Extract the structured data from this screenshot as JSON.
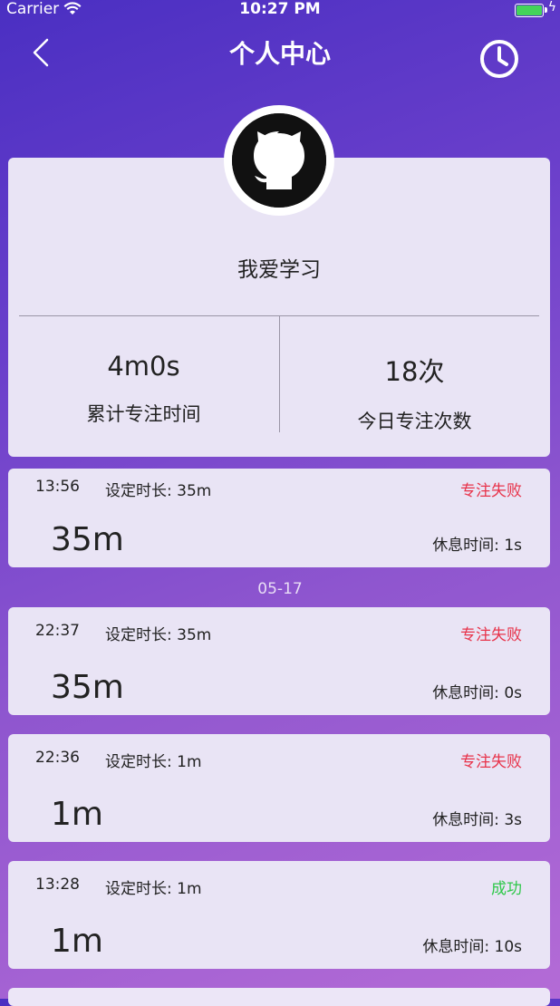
{
  "status_bar": {
    "carrier": "Carrier",
    "time": "10:27 PM"
  },
  "nav": {
    "title": "个人中心",
    "back_icon": "chevron-left-icon",
    "history_icon": "clock-icon"
  },
  "profile": {
    "avatar_icon": "github-octocat-icon",
    "username": "我爱学习",
    "stats": [
      {
        "value": "4m0s",
        "label": "累计专注时间"
      },
      {
        "value": "18次",
        "label": "今日专注次数"
      }
    ]
  },
  "records_top": [
    {
      "time": "13:56",
      "setting": "设定时长:  35m",
      "status": "专注失败",
      "duration": "35m",
      "rest": "休息时间: 1s"
    }
  ],
  "date_separator": "05-17",
  "records": [
    {
      "time": "22:37",
      "setting": "设定时长:  35m",
      "status": "专注失败",
      "duration": "35m",
      "rest": "休息时间: 0s"
    },
    {
      "time": "22:36",
      "setting": "设定时长:  1m",
      "status": "专注失败",
      "duration": "1m",
      "rest": "休息时间: 3s"
    },
    {
      "time": "13:28",
      "setting": "设定时长:  1m",
      "status": "成功",
      "duration": "1m",
      "rest": "休息时间: 10s"
    }
  ],
  "colors": {
    "fail": "#e8334a",
    "success": "#2fc84a",
    "card": "#e9e4f5"
  }
}
